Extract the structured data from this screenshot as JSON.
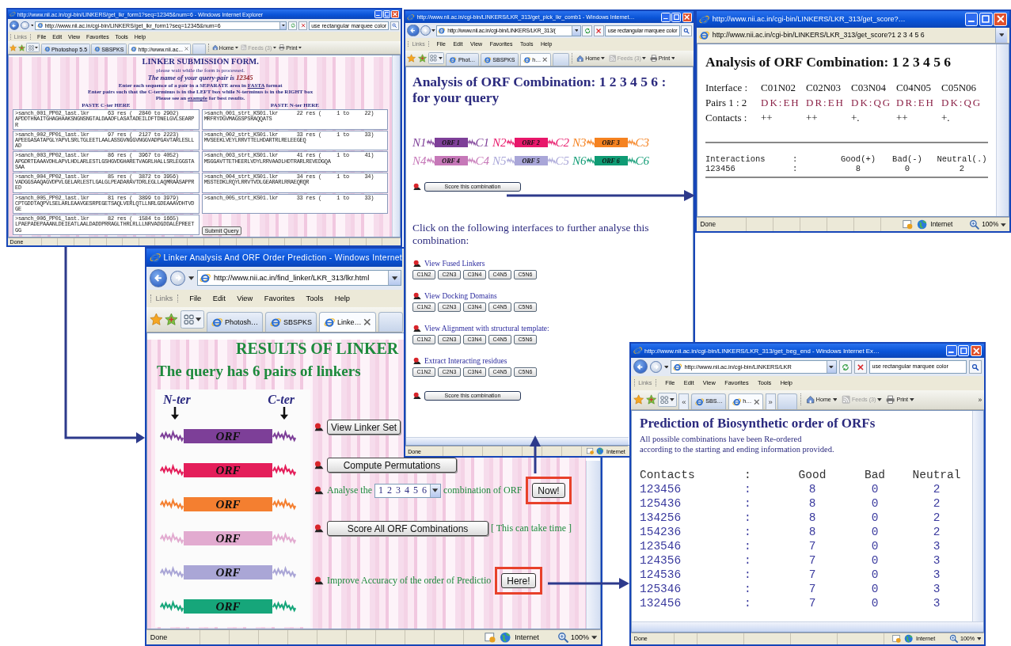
{
  "windows": [
    {
      "kind": "form",
      "title": "http://www.nii.ac.in/cgi-bin/LINKERS/get_lkr_form1?seq=12345&num=6 - Windows Internet Explorer",
      "address": "http://www.nii.ac.in/cgi-bin/LINKERS/get_lkr_form1?seq=12345&num=6",
      "search": "use rectangular marquee color",
      "links_label": "Links",
      "menu": [
        "File",
        "Edit",
        "View",
        "Favorites",
        "Tools",
        "Help"
      ],
      "tabs": [
        {
          "label": "Photoshop 5.5",
          "selected": false
        },
        {
          "label": "SBSPKS",
          "selected": false
        },
        {
          "label": "http://www.nii.ac...",
          "selected": true
        }
      ],
      "toolbar": [
        {
          "label": "Home",
          "disabled": false
        },
        {
          "label": "Feeds (3)",
          "disabled": true
        },
        {
          "label": "Print",
          "disabled": false
        }
      ],
      "heading": "LINKER SUBMISSION FORM.",
      "note": "please wait while the form is processed.",
      "query_text": "The name of your query-pair is",
      "query_name": "12345",
      "instructions": [
        {
          "text": "Enter each sequence of a pair in a SEPARATE area in",
          "link": "FASTA",
          "after": "format"
        },
        {
          "text": "Enter pairs such that the C-terminus is in the LEFT box while N-terminus is in the RIGHT box"
        },
        {
          "text": "Please see an",
          "link": "example",
          "after": "for best results."
        }
      ],
      "columns": [
        "PASTE C-ter HERE",
        "PASTE N-ter HERE"
      ],
      "pairs": [
        {
          "c": ">sanch_001_PP02_last.lkr      63 res (  2840 to 2902)\nAPDDTHNAITGHAGHAAKSNGNSNGTALDAADFLASATADEILDFTDNELGVLSEARPR",
          "n": ">sanch_001_strt_KS01.lkr      22 res (     1 to     22)\nMRFRYDGVMAGSSPSRAQQATS"
        },
        {
          "c": ">sanch_002_PP01_last.lkr      97 res (  2127 to 2223)\nAPEEGASATAPGLYAPVLSRLTGLEETLAALASSGVNGGVNGGVADPGAVTARLESLLAD",
          "n": ">sanch_002_strt_KS01.lkr      33 res (     1 to     33)\nMVSEEKLVEYLRRVTTELHDARTRLRELEEGEQ"
        },
        {
          "c": ">sanch_003_PP02_last.lkr      86 res (  3967 to 4052)\nAPGDRTEAAAVDHLAPVLHDLARLESTLGSHGVDGHARETVAGRLHALLSRLEGGSTASAA",
          "n": ">sanch_003_strt_KS01.lkr      41 res (     1 to     41)\nMSGGAVTTETHEERLVDYLRRVAADLHDTRARLREVEDGQA"
        },
        {
          "c": ">sanch_004_PP02_last.lkr      85 res (  3872 to 3956)\nVADGGSAAQAGVDPVLGELARLESTLGALGLPEADARAVTDRLEGLLAQMRAASAPPRED",
          "n": ">sanch_004_strt_KS01.lkr      34 res (     1 to     34)\nMSSTEDKLRQYLRRVTVDLGEARARLRRAEQRQR"
        },
        {
          "c": ">sanch_005_PP02_last.lkr      81 res (  3899 to 3979)\nCPTGDDTAQPVLSELARLEAAVGESRPEGETSAQLVERLQTLLNRLGDEAAAVDHTVDGE",
          "n": ">sanch_005_strt_KS01.lkr      33 res (     1 to     33)"
        },
        {
          "c": ">sanch_006_PP01_last.lkr      82 res (  1584 to 1665)\nLPAEPADEPAAANLDEIEATLAALDADDPRRAGLTHRLRLLLNRVADGDDALEPREETGG"
        }
      ],
      "submit": "Submit Query",
      "status": {
        "text": "Done"
      }
    },
    {
      "kind": "results",
      "title": "Linker Analysis And ORF Order Prediction - Windows Internet",
      "address": "http://www.nii.ac.in/find_linker/LKR_313/lkr.html",
      "links_label": "Links",
      "menu": [
        "File",
        "Edit",
        "View",
        "Favorites",
        "Tools",
        "Help"
      ],
      "tabs": [
        {
          "label": "Photosh…",
          "selected": false
        },
        {
          "label": "SBSPKS",
          "selected": false
        },
        {
          "label": "Linke…",
          "selected": true
        }
      ],
      "heading": "RESULTS OF LINKER",
      "subheading": "The query has 6 pairs of linkers",
      "ends": [
        "N-ter",
        "C-ter"
      ],
      "orfs": [
        {
          "label": "ORF",
          "color": "#7d3f98"
        },
        {
          "label": "ORF",
          "color": "#e41e5a"
        },
        {
          "label": "ORF",
          "color": "#f47f30"
        },
        {
          "label": "ORF",
          "color": "#e2abd0"
        },
        {
          "label": "ORF",
          "color": "#aaa6d6"
        },
        {
          "label": "ORF",
          "color": "#16a67a"
        }
      ],
      "actions": [
        {
          "kind": "button",
          "label": "View Linker Set"
        },
        {
          "kind": "button",
          "label": "Compute Permutations"
        },
        {
          "kind": "select",
          "before": "Analyse the",
          "value": "1 2 3 4 5 6",
          "after": "combination of ORF",
          "button": "Now!"
        },
        {
          "kind": "button",
          "label": "Score All ORF Combinations",
          "note": "[ This can take time ]"
        },
        {
          "kind": "link",
          "text": "Improve Accuracy of the order of Predictio",
          "button": "Here!"
        }
      ],
      "status": {
        "text": "Done",
        "zone": "Internet",
        "zoom": "100%"
      }
    },
    {
      "kind": "combination",
      "title": "http://www.nii.ac.in/cgi-bin/LINKERS/LKR_313/get_pick_lkr_comb1 - Windows Internet…",
      "address": "http://www.nii.ac.in/cgi-bin/LINKERS/LKR_313/(",
      "search": "use rectangular marquee color",
      "links_label": "Links",
      "menu": [
        "File",
        "Edit",
        "View",
        "Favorites",
        "Tools",
        "Help"
      ],
      "tabs": [
        {
          "label": "Phot…",
          "selected": false
        },
        {
          "label": "SBSPKS",
          "selected": false
        },
        {
          "label": "h…",
          "selected": true
        }
      ],
      "toolbar": [
        {
          "label": "Home",
          "disabled": false
        },
        {
          "label": "Feeds (3)",
          "disabled": true
        },
        {
          "label": "Print",
          "disabled": false
        }
      ],
      "heading": "Analysis of ORF Combination: 1 2 3 4 5 6 : for your query",
      "orf_items": [
        {
          "n": "N1",
          "orf": "ORF 1",
          "c": "C1",
          "color": "#7e3f98"
        },
        {
          "n": "N2",
          "orf": "ORF 2",
          "c": "C2",
          "color": "#e8176a"
        },
        {
          "n": "N3",
          "orf": "ORF 3",
          "c": "C3",
          "color": "#f58220"
        },
        {
          "n": "N4",
          "orf": "ORF 4",
          "c": "C4",
          "color": "#c678b8"
        },
        {
          "n": "N5",
          "orf": "ORF 5",
          "c": "C5",
          "color": "#a9a6d8"
        },
        {
          "n": "N6",
          "orf": "ORF 6",
          "c": "C6",
          "color": "#0f9b74"
        }
      ],
      "score_button": "Score this combination",
      "prompt": "Click on the following interfaces to further analyse this combination:",
      "sections": [
        {
          "link": "View Fused Linkers",
          "buttons": [
            "C1N2",
            "C2N3",
            "C3N4",
            "C4N5",
            "C5N6"
          ]
        },
        {
          "link": "View Docking Domains",
          "buttons": [
            "C1N2",
            "C2N3",
            "C3N4",
            "C4N5",
            "C5N6"
          ]
        },
        {
          "link": "View Alignment with structural template:",
          "buttons": [
            "C1N2",
            "C2N3",
            "C3N4",
            "C4N5",
            "C5N6"
          ]
        },
        {
          "link": "Extract Interacting residues",
          "buttons": [
            "C1N2",
            "C2N3",
            "C3N4",
            "C4N5",
            "C5N6"
          ]
        }
      ],
      "final_button": "Score this combination",
      "status": {
        "text": "Done",
        "zone": "Internet"
      }
    },
    {
      "kind": "score",
      "title": "http://www.nii.ac.in/cgi-bin/LINKERS/LKR_313/get_score?…",
      "address": "http://www.nii.ac.in/cgi-bin/LINKERS/LKR_313/get_score?1 2 3 4 5 6",
      "heading": "Analysis of ORF Combination: 1 2 3 4 5 6",
      "interface_rows": [
        [
          "Interface :",
          "C01N02",
          "C02N03",
          "C03N04",
          "C04N05",
          "C05N06"
        ],
        [
          "Pairs 1 : 2",
          "DK:EH",
          "DR:EH",
          "DK:QG",
          "DR:EH",
          "DK:QG"
        ],
        [
          "Contacts :",
          "++",
          "++",
          "+.",
          "++",
          "+."
        ]
      ],
      "summary": {
        "columns": [
          "Interactions",
          ":",
          "Good(+)",
          "Bad(-)",
          "Neutral(.)"
        ],
        "rows": [
          [
            "123456",
            ":",
            "8",
            "0",
            "2"
          ]
        ]
      },
      "status": {
        "text": "Done",
        "zone": "Internet",
        "zoom": "100%"
      }
    },
    {
      "kind": "order",
      "title": "http://www.nii.ac.in/cgi-bin/LINKERS/LKR_313/get_beg_end - Windows Internet Ex…",
      "address": "http://www.nii.ac.in/cgi-bin/LINKERS/LKR",
      "search": "use rectangular marquee color",
      "links_label": "Links",
      "menu": [
        "File",
        "Edit",
        "View",
        "Favorites",
        "Tools",
        "Help"
      ],
      "tab_scroll_left": "«",
      "tabs": [
        {
          "label": "SBS…",
          "selected": false
        },
        {
          "label": "h…",
          "selected": true
        }
      ],
      "tab_scroll_right": "»",
      "toolbar": [
        {
          "label": "Home",
          "disabled": false
        },
        {
          "label": "Feeds (3)",
          "disabled": true
        },
        {
          "label": "Print",
          "disabled": false
        }
      ],
      "toolbar_more": "»",
      "heading": "Prediction of Biosynthetic order of ORFs",
      "description": "All possible combinations have been Re-ordered\naccording to the starting and ending information provided.",
      "table": {
        "columns": [
          "Contacts",
          ":",
          "Good",
          "Bad",
          "Neutral"
        ],
        "rows": [
          [
            "123456",
            ":",
            "8",
            "0",
            "2"
          ],
          [
            "125436",
            ":",
            "8",
            "0",
            "2"
          ],
          [
            "134256",
            ":",
            "8",
            "0",
            "2"
          ],
          [
            "154236",
            ":",
            "8",
            "0",
            "2"
          ],
          [
            "123546",
            ":",
            "7",
            "0",
            "3"
          ],
          [
            "124356",
            ":",
            "7",
            "0",
            "3"
          ],
          [
            "124536",
            ":",
            "7",
            "0",
            "3"
          ],
          [
            "125346",
            ":",
            "7",
            "0",
            "3"
          ],
          [
            "132456",
            ":",
            "7",
            "0",
            "3"
          ]
        ]
      },
      "status": {
        "text": "Done",
        "zone": "Internet",
        "zoom": "100%"
      }
    }
  ]
}
